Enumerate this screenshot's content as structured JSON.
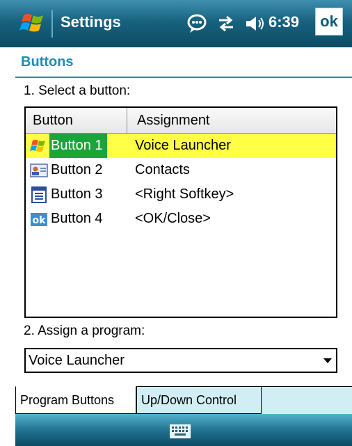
{
  "titlebar": {
    "app_title": "Settings",
    "time": "6:39",
    "ok_label": "ok",
    "icons": [
      "windows-start-icon",
      "notification-bubble-icon",
      "connectivity-icon",
      "volume-icon"
    ]
  },
  "page": {
    "title": "Buttons"
  },
  "step1_label": "1. Select a button:",
  "list": {
    "columns": [
      "Button",
      "Assignment"
    ],
    "rows": [
      {
        "button": "Button 1",
        "assignment": "Voice Launcher",
        "icon": "windows-flag-icon",
        "selected": true
      },
      {
        "button": "Button 2",
        "assignment": "Contacts",
        "icon": "contact-card-icon",
        "selected": false
      },
      {
        "button": "Button 3",
        "assignment": "<Right Softkey>",
        "icon": "softkey-icon",
        "selected": false
      },
      {
        "button": "Button 4",
        "assignment": "<OK/Close>",
        "icon": "ok-icon",
        "selected": false
      }
    ]
  },
  "step2_label": "2. Assign a program:",
  "program_select": {
    "value": "Voice Launcher"
  },
  "tabs": [
    "Program Buttons",
    "Up/Down Control"
  ],
  "colors": {
    "title_bar": "#18627f",
    "page_title": "#1e8cb5",
    "selected_row": "#ffff48",
    "selected_cell": "#1aa53a",
    "tab_strip": "#d2eef5"
  }
}
